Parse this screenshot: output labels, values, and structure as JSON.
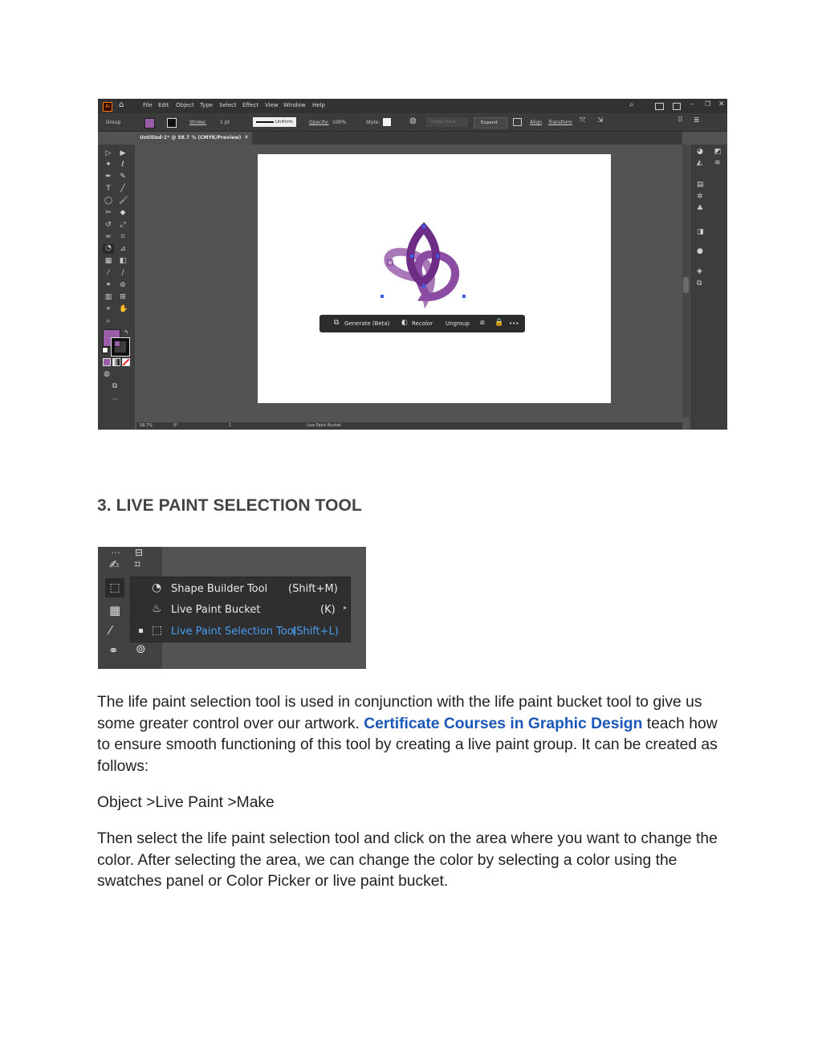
{
  "illustrator": {
    "menu": [
      "File",
      "Edit",
      "Object",
      "Type",
      "Select",
      "Effect",
      "View",
      "Window",
      "Help"
    ],
    "control": {
      "group_label": "Group",
      "stroke_label": "Stroke:",
      "stroke_value": "1 pt",
      "uniform_label": "Uniform",
      "opacity_label": "Opacity:",
      "opacity_value": "100%",
      "style_label": "Style:",
      "image_trace_label": "Image Trace",
      "expand_label": "Expand",
      "align_label": "Align",
      "transform_label": "Transform"
    },
    "document_tab": "Untitled-1* @ 58.7 % (CMYK/Preview)",
    "contextual_bar": {
      "generate": "Generate (Beta)",
      "recolor": "Recolor",
      "ungroup": "Ungroup",
      "more": "•••"
    },
    "status": {
      "zoom": "58.7%",
      "rotation": "0°",
      "artboard": "1",
      "tool": "Live Paint Bucket"
    },
    "colors": {
      "fill": "#9a5ea8",
      "knot_light": "#a878b9",
      "knot_dark": "#6d2c86",
      "selection": "#3a5cf0"
    }
  },
  "section": {
    "heading": "3. LIVE PAINT SELECTION TOOL"
  },
  "flyout": {
    "items": [
      {
        "label": "Shape Builder Tool",
        "shortcut": "(Shift+M)"
      },
      {
        "label": "Live Paint Bucket",
        "shortcut": "(K)"
      },
      {
        "label": "Live Paint Selection Tool",
        "shortcut": "(Shift+L)"
      }
    ],
    "active_color": "#4a9cf1"
  },
  "body": {
    "para1_a": "The life paint selection tool is used in conjunction with the life paint bucket tool to give us some greater control over our artwork. ",
    "para1_link": "Certificate Courses in Graphic Design",
    "para1_b": " teach how to ensure smooth functioning of this tool by creating a live paint group. It can be created as follows:",
    "para2": "Object >Live Paint >Make",
    "para3": "Then select the life paint selection tool and click on the area where you want to change the color. After selecting the area, we can change the color by selecting a color using the swatches panel or Color Picker or live paint bucket."
  }
}
